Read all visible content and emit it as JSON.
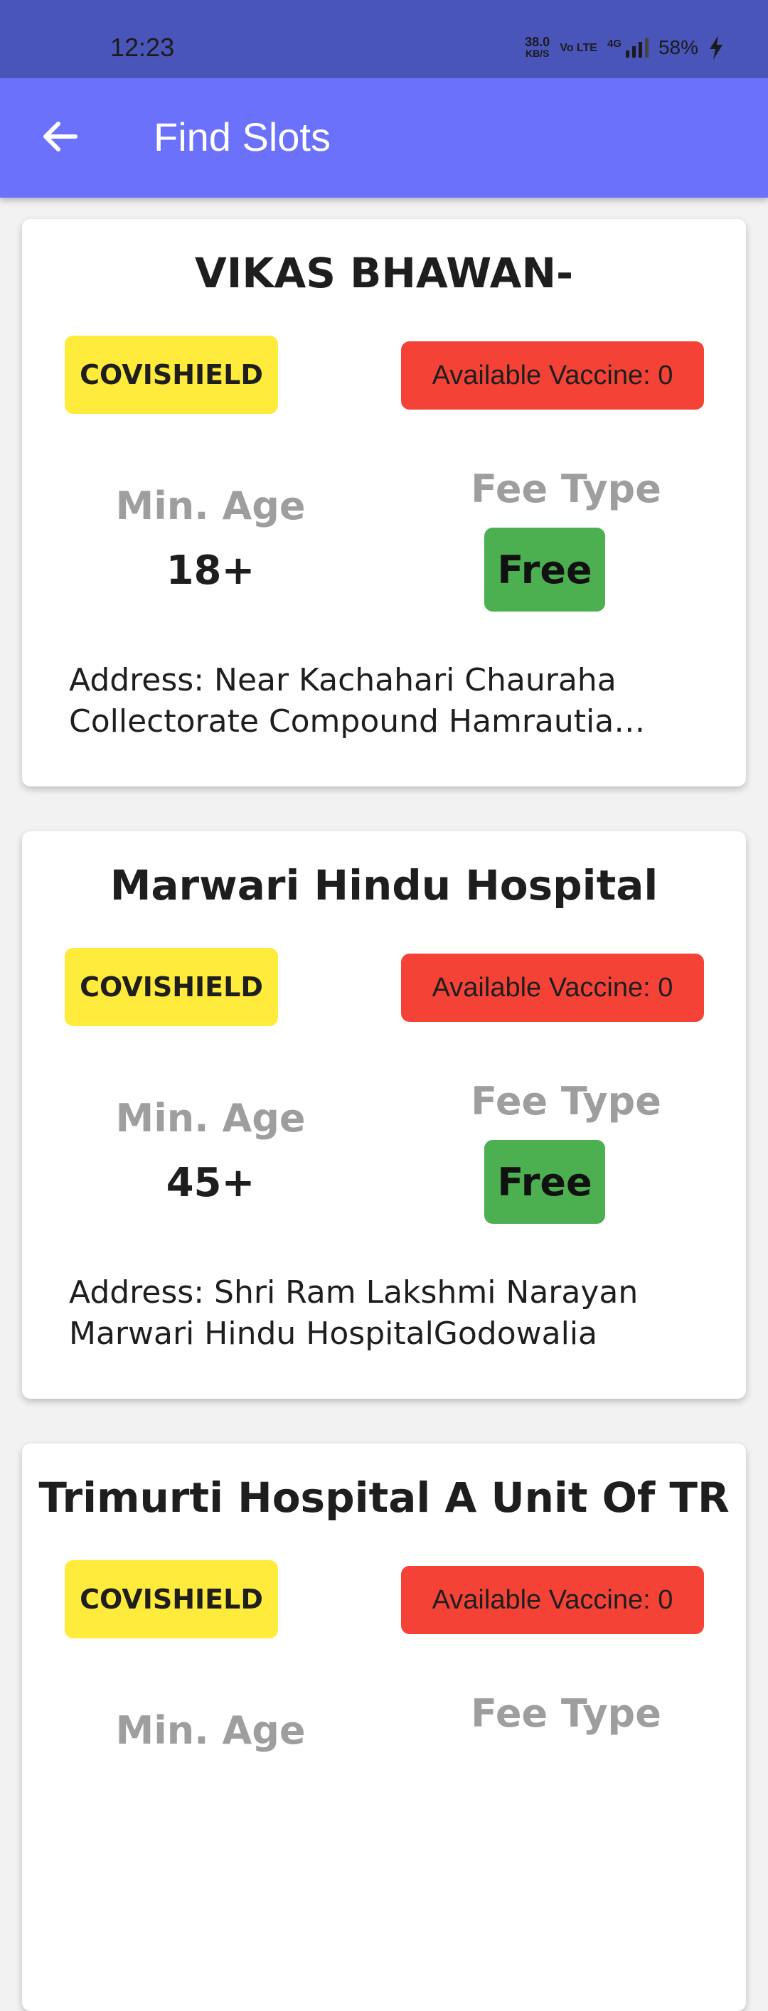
{
  "status_bar": {
    "time": "12:23",
    "speed_value": "38.0",
    "speed_unit": "KB/S",
    "volte": "Vo LTE",
    "network": "4G",
    "battery": "58%"
  },
  "app_bar": {
    "title": "Find Slots",
    "back_icon": "arrow-left-icon"
  },
  "centers": [
    {
      "name": "VIKAS BHAWAN-",
      "vaccine": "COVISHIELD",
      "availability": "Available Vaccine: 0",
      "min_age_label": "Min. Age",
      "min_age": "18+",
      "fee_type_label": "Fee Type",
      "fee_type": "Free",
      "address": "Address: Near Kachahari Chauraha Collectorate Compound Hamrautia Bhikhampur Road Bhikhampur"
    },
    {
      "name": "Marwari Hindu Hospital",
      "vaccine": "COVISHIELD",
      "availability": "Available Vaccine: 0",
      "min_age_label": "Min. Age",
      "min_age": "45+",
      "fee_type_label": "Fee Type",
      "fee_type": "Free",
      "address": "Address: Shri Ram Lakshmi Narayan Marwari Hindu HospitalGodowalia"
    },
    {
      "name": "Trimurti Hospital A Unit Of TR",
      "vaccine": "COVISHIELD",
      "availability": "Available Vaccine: 0",
      "min_age_label": "Min. Age",
      "min_age": "",
      "fee_type_label": "Fee Type",
      "fee_type": "",
      "address": ""
    }
  ],
  "colors": {
    "status_bar": "#4a55b9",
    "app_bar": "#6b71fb",
    "vaccine_chip": "#ffeb3b",
    "availability_chip": "#f44336",
    "fee_chip": "#4caf50"
  }
}
